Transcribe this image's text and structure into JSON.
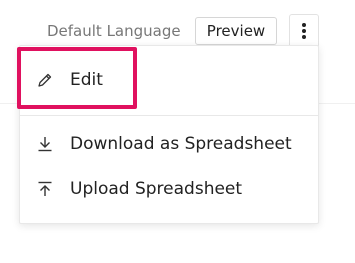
{
  "header": {
    "language_label": "Default Language",
    "preview_label": "Preview",
    "more_icon": "more-vertical-icon"
  },
  "menu": {
    "items": [
      {
        "label": "Edit",
        "icon": "pencil-icon"
      },
      {
        "label": "Download as Spreadsheet",
        "icon": "download-icon"
      },
      {
        "label": "Upload Spreadsheet",
        "icon": "upload-icon"
      }
    ]
  },
  "colors": {
    "highlight": "#e0115f",
    "text": "#222222",
    "muted_text": "#777777",
    "border": "#d6d6d6"
  }
}
